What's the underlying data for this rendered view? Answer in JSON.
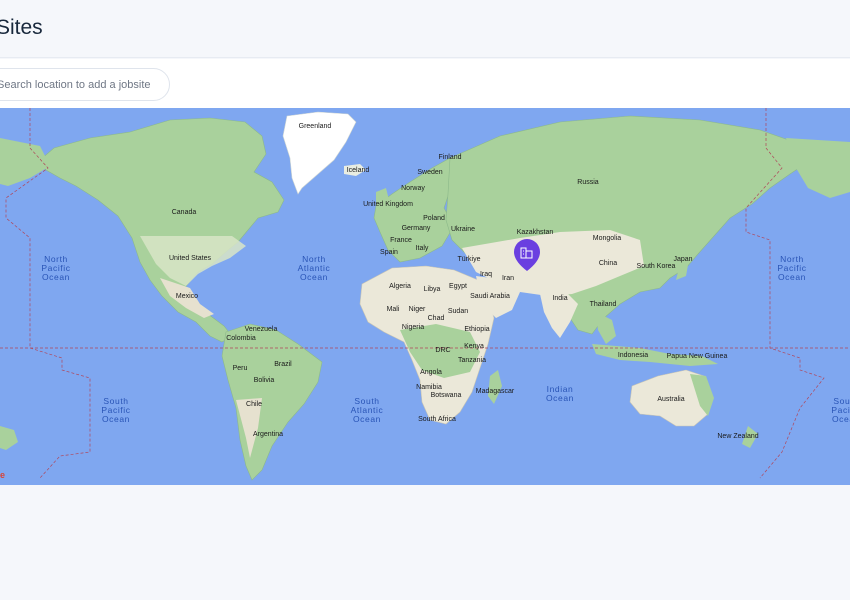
{
  "header": {
    "title": "Sites"
  },
  "search": {
    "placeholder": "Search location to add a jobsite",
    "value": ""
  },
  "map": {
    "country_labels": [
      "Greenland",
      "Finland",
      "Iceland",
      "Sweden",
      "Norway",
      "Russia",
      "United Kingdom",
      "Poland",
      "Germany",
      "Ukraine",
      "Kazakhstan",
      "France",
      "Italy",
      "Mongolia",
      "Spain",
      "Türkiye",
      "Iraq",
      "Iran",
      "Japan",
      "China",
      "South Korea",
      "Canada",
      "United States",
      "Mexico",
      "Algeria",
      "Libya",
      "Egypt",
      "Saudi Arabia",
      "India",
      "Mali",
      "Niger",
      "Chad",
      "Sudan",
      "Nigeria",
      "Ethiopia",
      "DRC",
      "Kenya",
      "Tanzania",
      "Thailand",
      "Venezuela",
      "Colombia",
      "Brazil",
      "Peru",
      "Bolivia",
      "Chile",
      "Argentina",
      "Angola",
      "Namibia",
      "Botswana",
      "Madagascar",
      "South Africa",
      "Indonesia",
      "Papua New Guinea",
      "Australia",
      "New Zealand"
    ],
    "ocean_labels": [
      {
        "name": "North Pacific Ocean"
      },
      {
        "name": "North Atlantic Ocean"
      },
      {
        "name": "North Pacific Ocean"
      },
      {
        "name": "South Pacific Ocean"
      },
      {
        "name": "South Atlantic Ocean"
      },
      {
        "name": "Indian Ocean"
      },
      {
        "name": "South Pacific Ocean"
      }
    ],
    "marker": {
      "icon": "building-icon",
      "color": "#6a3fe0",
      "location": "Afghanistan/Pakistan region"
    },
    "colors": {
      "water": "#7fa7f0",
      "land": "#f0efe9",
      "vegetation": "#a8d5a0",
      "ice": "#ffffff",
      "dateline": "#b0465a"
    },
    "attribution_mark": "e"
  }
}
